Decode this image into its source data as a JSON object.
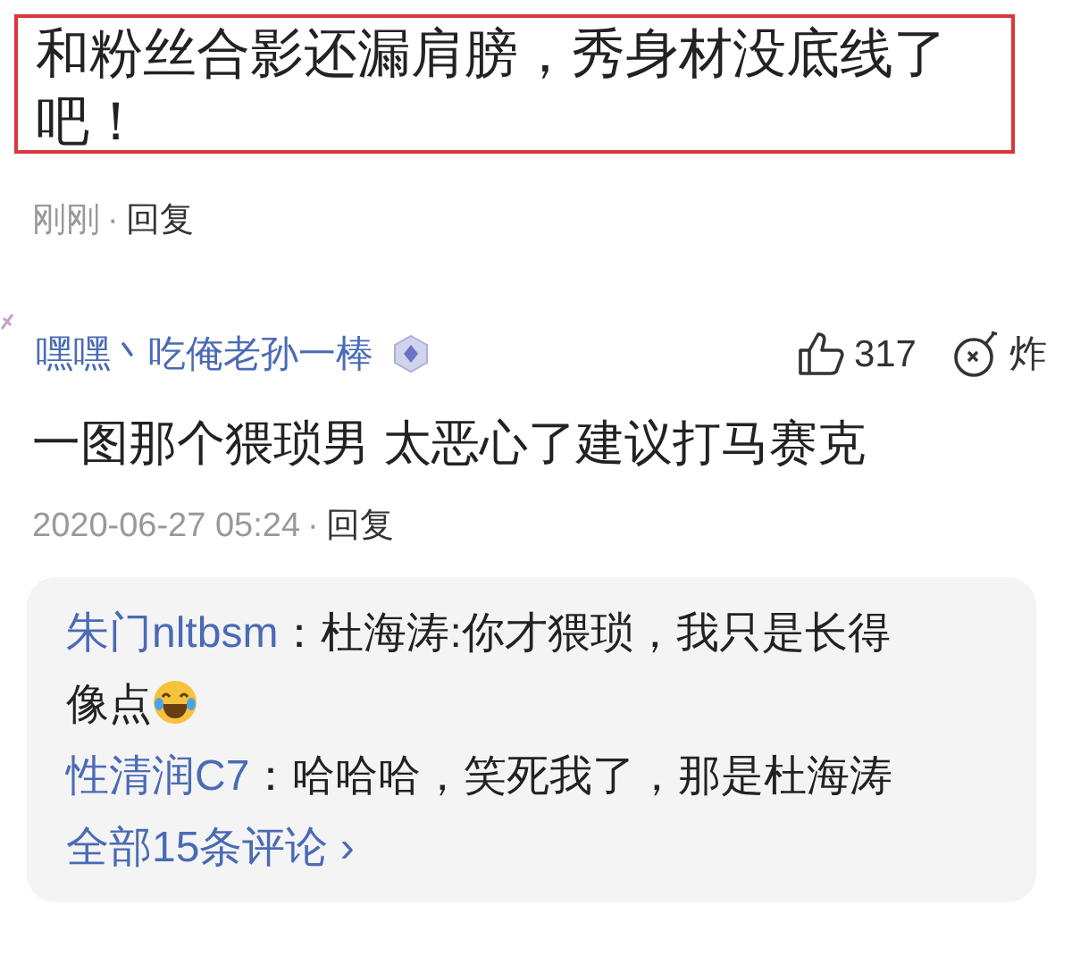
{
  "quoted_comment": {
    "text": "和粉丝合影还漏肩膀，秀身材没底线了吧！",
    "time": "刚刚",
    "separator": "·",
    "reply": "回复"
  },
  "comment": {
    "author": "嘿嘿丶吃俺老孙一棒",
    "likes": "317",
    "bomb_label": "炸",
    "text": "一图那个猥琐男 太恶心了建议打马赛克",
    "time": "2020-06-27 05:24",
    "separator": "·",
    "reply": "回复",
    "replies": [
      {
        "author": "朱门nltbsm",
        "text_lines": [
          "：杜海涛:你才猥琐，我只是长得",
          "像点"
        ],
        "emoji": true
      },
      {
        "author": "性清润C7",
        "text_lines": [
          "：哈哈哈，笑死我了，那是杜海涛"
        ],
        "emoji": false
      }
    ],
    "more_link": "全部15条评论",
    "more_chevron": "›"
  }
}
